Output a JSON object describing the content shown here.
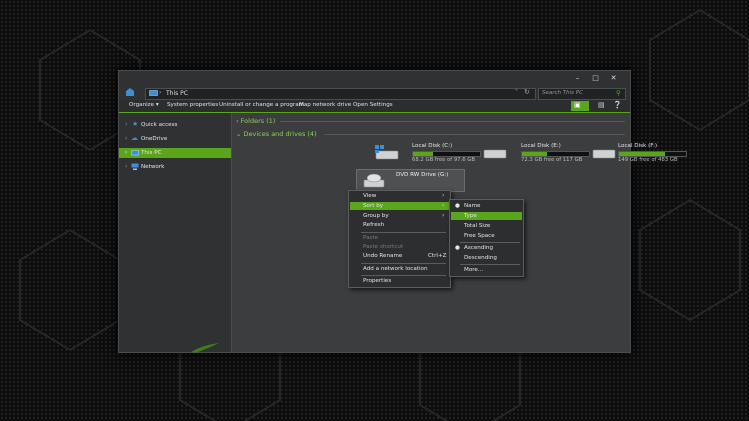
{
  "window": {
    "title": "This PC"
  },
  "address": {
    "path": "This PC",
    "search_placeholder": "Search This PC"
  },
  "toolbar": {
    "items": [
      "Organize ▾",
      "System properties",
      "Uninstall or change a program",
      "Map network drive",
      "Open Settings"
    ]
  },
  "sidebar": {
    "items": [
      {
        "label": "Quick access",
        "icon": "star-icon"
      },
      {
        "label": "OneDrive",
        "icon": "cloud-icon"
      },
      {
        "label": "This PC",
        "icon": "computer-icon",
        "selected": true
      },
      {
        "label": "Network",
        "icon": "network-icon"
      }
    ]
  },
  "content": {
    "folders_header": "Folders (1)",
    "devices_header": "Devices and drives (4)",
    "drives": [
      {
        "name": "Local Disk (C:)",
        "free": "68.2 GB free of 97.6 GB",
        "used_fraction": 0.3
      },
      {
        "name": "Local Disk (E:)",
        "free": "72.3 GB free of 117 GB",
        "used_fraction": 0.38
      },
      {
        "name": "Local Disk (F:)",
        "free": "149 GB free of 483 GB",
        "used_fraction": 0.69
      },
      {
        "name": "DVD RW Drive (G:)",
        "free": ""
      }
    ]
  },
  "context_menu": {
    "view": "View",
    "sort_by": "Sort by",
    "group_by": "Group by",
    "refresh": "Refresh",
    "paste": "Paste",
    "paste_shortcut": "Paste shortcut",
    "undo_rename": "Undo Rename",
    "undo_shortcut": "Ctrl+Z",
    "add_network": "Add a network location",
    "properties": "Properties"
  },
  "sort_menu": {
    "name": "Name",
    "type": "Type",
    "total_size": "Total Size",
    "free_space": "Free Space",
    "ascending": "Ascending",
    "descending": "Descending",
    "more": "More..."
  },
  "colors": {
    "accent": "#5aa51c",
    "window_bg": "#3b3d3e",
    "sidebar_bg": "#2f3132"
  }
}
